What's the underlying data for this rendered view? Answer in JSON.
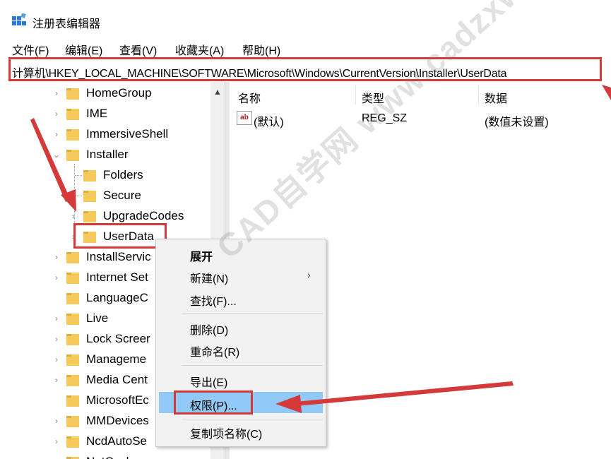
{
  "window": {
    "title": "注册表编辑器"
  },
  "menu": [
    "文件(F)",
    "编辑(E)",
    "查看(V)",
    "收藏夹(A)",
    "帮助(H)"
  ],
  "address": {
    "path": "计算机\\HKEY_LOCAL_MACHINE\\SOFTWARE\\Microsoft\\Windows\\CurrentVersion\\Installer\\UserData"
  },
  "tree": {
    "items": [
      {
        "label": "HomeGroup"
      },
      {
        "label": "IME"
      },
      {
        "label": "ImmersiveShell"
      },
      {
        "label": "Installer"
      },
      {
        "label": "Folders"
      },
      {
        "label": "Secure"
      },
      {
        "label": "UpgradeCodes"
      },
      {
        "label": "UserData"
      },
      {
        "label": "InstallServic"
      },
      {
        "label": "Internet Set"
      },
      {
        "label": "LanguageC"
      },
      {
        "label": "Live"
      },
      {
        "label": "Lock Screer"
      },
      {
        "label": "Manageme"
      },
      {
        "label": "Media Cent"
      },
      {
        "label": "MicrosoftEc"
      },
      {
        "label": "MMDevices"
      },
      {
        "label": "NcdAutoSe"
      },
      {
        "label": "NetCache"
      }
    ]
  },
  "list": {
    "columns": [
      "名称",
      "类型",
      "数据"
    ],
    "rows": [
      {
        "name": "(默认)",
        "type": "REG_SZ",
        "data": "(数值未设置)"
      }
    ]
  },
  "context_menu": {
    "expand": "展开",
    "new": "新建(N)",
    "find": "查找(F)...",
    "delete": "删除(D)",
    "rename": "重命名(R)",
    "export": "导出(E)",
    "permissions": "权限(P)...",
    "copy_key_name": "复制项名称(C)"
  },
  "watermark": "CAD自学网 www.cadzxw.com",
  "colors": {
    "annotation_red": "#d43a3a",
    "folder_yellow": "#f5c95a",
    "highlight_blue": "#91c9f7"
  }
}
